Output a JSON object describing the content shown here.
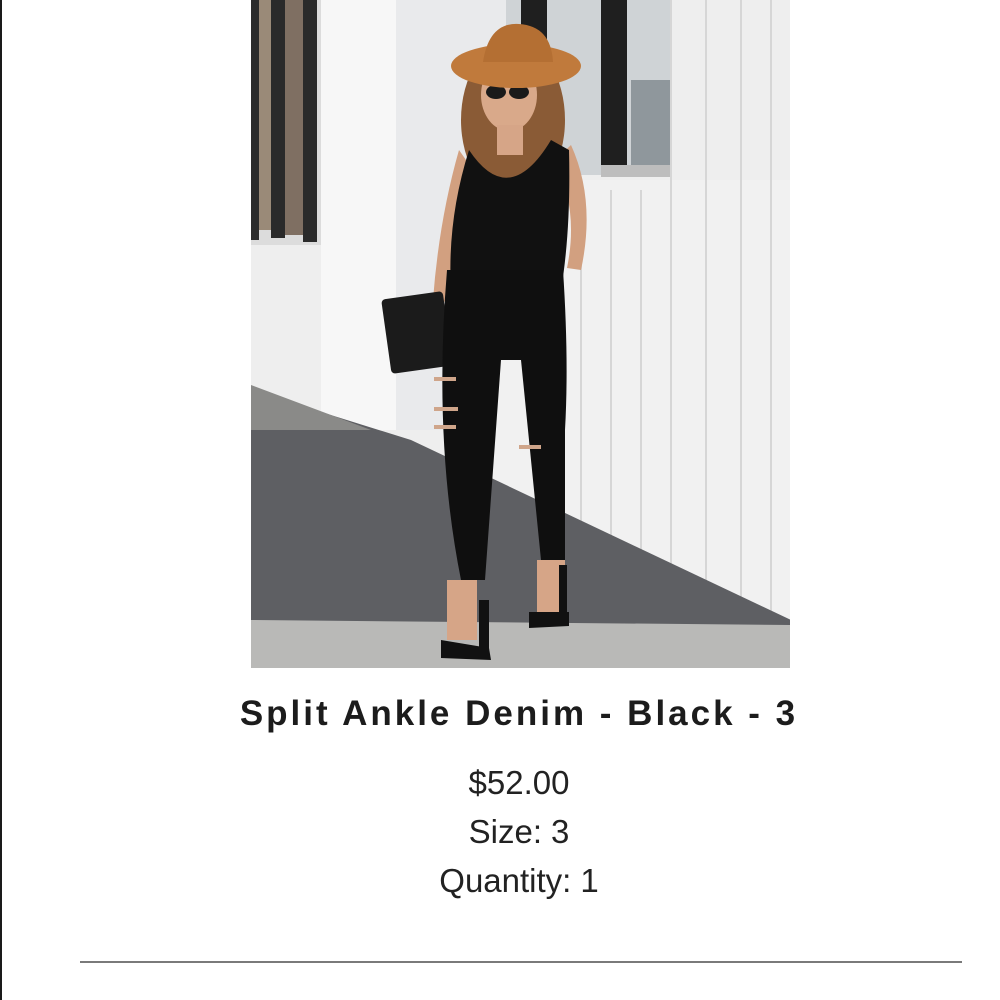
{
  "product": {
    "title": "Split Ankle Denim - Black - 3",
    "price": "$52.00",
    "size_label": "Size:",
    "size_value": "3",
    "quantity_label": "Quantity:",
    "quantity_value": "1"
  },
  "colors": {
    "title_text": "#1c1c1c",
    "detail_text": "#222222",
    "divider": "#7a7a7a",
    "hat": "#c07a3c",
    "clothing": "#111111"
  }
}
